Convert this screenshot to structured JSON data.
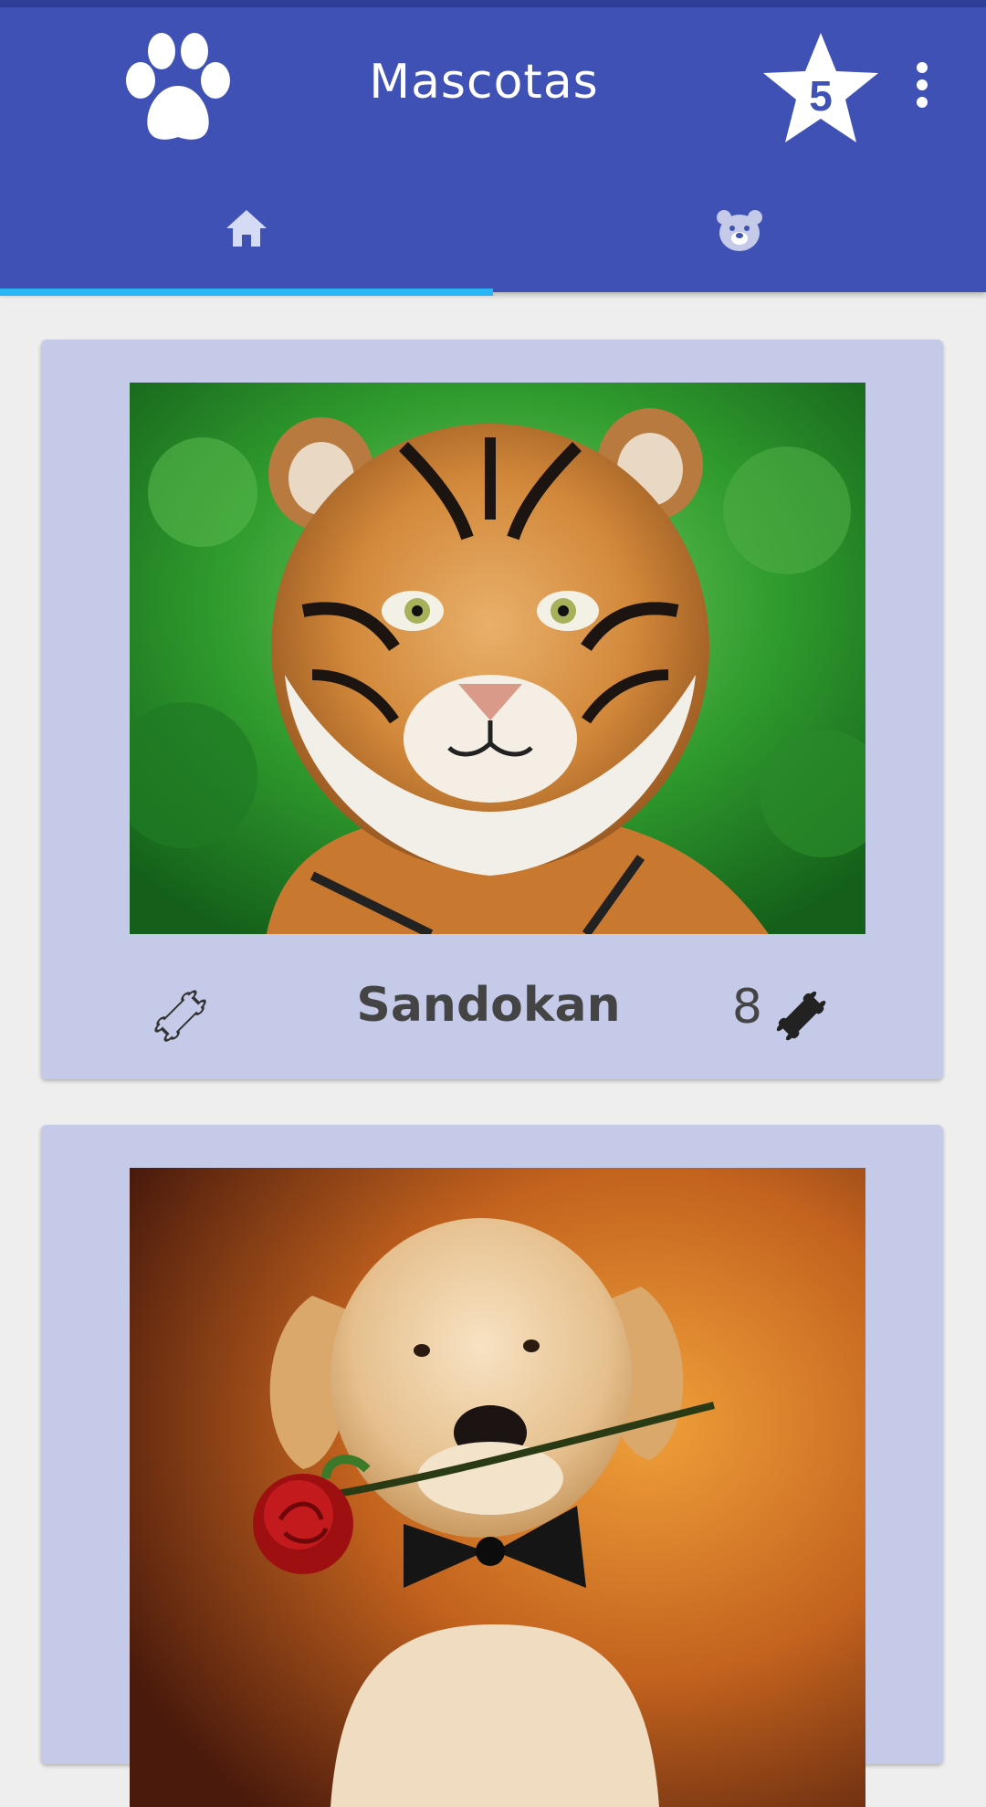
{
  "appbar": {
    "title": "Mascotas",
    "favorites_count": "5",
    "logo_icon": "paw-icon",
    "favorites_icon": "star-icon",
    "menu_icon": "more-vert-icon",
    "color": "#3f51b5",
    "indicator_color": "#29b6f6"
  },
  "tabs": [
    {
      "icon": "home-icon",
      "selected": true
    },
    {
      "icon": "bear-icon",
      "selected": false
    }
  ],
  "cards": [
    {
      "name": "Sandokan",
      "likes": "8",
      "photo": "tiger-photo",
      "like_button_icon": "bone-outline-icon",
      "likes_icon": "bone-filled-icon"
    },
    {
      "name": "",
      "likes": "",
      "photo": "puppy-with-rose-photo"
    }
  ]
}
